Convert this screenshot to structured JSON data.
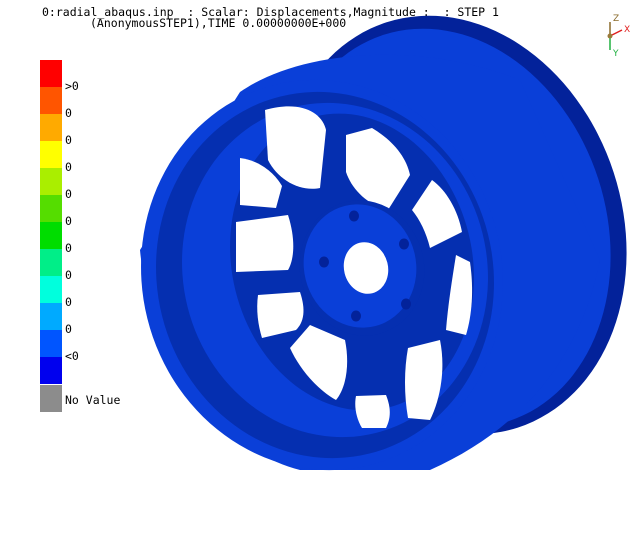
{
  "header": {
    "line1": "0:radial_abaqus.inp  : Scalar: Displacements,Magnitude :  : STEP 1",
    "line2": "(AnonymousSTEP1),TIME 0.00000000E+000"
  },
  "legend": {
    "entries": [
      {
        "color": "#ff0000",
        "label": ">0"
      },
      {
        "color": "#ff5500",
        "label": "0"
      },
      {
        "color": "#ffaa00",
        "label": "0"
      },
      {
        "color": "#ffff00",
        "label": "0"
      },
      {
        "color": "#aaee00",
        "label": "0"
      },
      {
        "color": "#55dd00",
        "label": "0"
      },
      {
        "color": "#00dd00",
        "label": "0"
      },
      {
        "color": "#00ee88",
        "label": "0"
      },
      {
        "color": "#00ffdd",
        "label": "0"
      },
      {
        "color": "#00aaff",
        "label": "0"
      },
      {
        "color": "#0055ff",
        "label": "<0"
      },
      {
        "color": "#0000ee",
        "label": ""
      }
    ],
    "no_value": {
      "color": "#8c8c8c",
      "label": "No Value"
    }
  },
  "model": {
    "color": "#0a3fd8",
    "shade": "#052fb0",
    "dark": "#03229a"
  },
  "triad": {
    "z_label": "Z",
    "x_label": "X",
    "y_label": "Y",
    "z_color": "#8a6a2a",
    "x_color": "#e02020",
    "y_color": "#20b040"
  }
}
